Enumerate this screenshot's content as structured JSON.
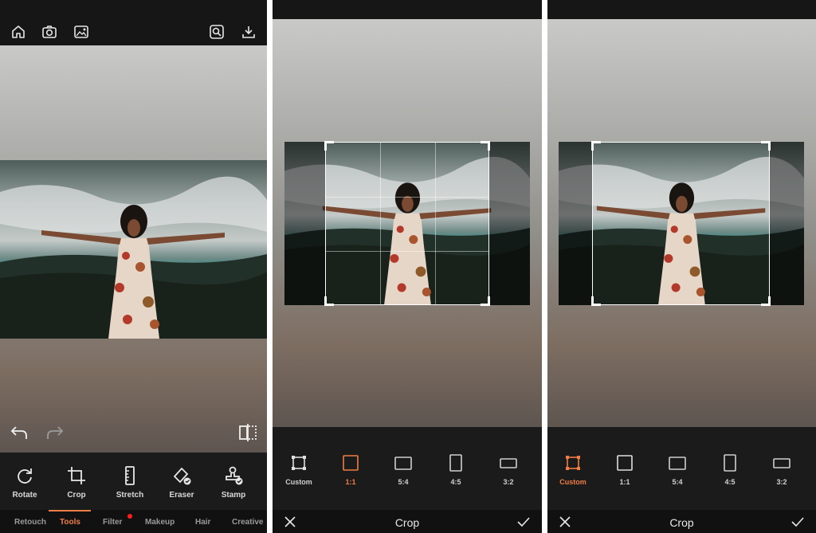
{
  "editor": {
    "toolbar_icons": [
      "home-icon",
      "camera-icon",
      "gallery-icon",
      "search-image-icon",
      "download-icon"
    ],
    "tools": [
      {
        "label": "Rotate",
        "icon": "rotate-icon"
      },
      {
        "label": "Crop",
        "icon": "crop-icon"
      },
      {
        "label": "Stretch",
        "icon": "stretch-icon"
      },
      {
        "label": "Eraser",
        "icon": "eraser-icon"
      },
      {
        "label": "Stamp",
        "icon": "stamp-icon"
      }
    ],
    "tabs": [
      {
        "label": "Retouch"
      },
      {
        "label": "Tools"
      },
      {
        "label": "Filter"
      },
      {
        "label": "Makeup"
      },
      {
        "label": "Hair"
      },
      {
        "label": "Creative"
      }
    ],
    "active_tab": "Tools"
  },
  "crop_view_square": {
    "ratios": [
      {
        "label": "Custom"
      },
      {
        "label": "1:1"
      },
      {
        "label": "5:4"
      },
      {
        "label": "4:5"
      },
      {
        "label": "3:2"
      }
    ],
    "selected_ratio": "1:1",
    "title": "Crop"
  },
  "crop_view_custom": {
    "ratios": [
      {
        "label": "Custom"
      },
      {
        "label": "1:1"
      },
      {
        "label": "5:4"
      },
      {
        "label": "4:5"
      },
      {
        "label": "3:2"
      }
    ],
    "selected_ratio": "Custom",
    "title": "Crop"
  },
  "colors": {
    "accent": "#ef7d45",
    "notification_dot": "#ff1d1d",
    "panel_background": "#161616"
  }
}
